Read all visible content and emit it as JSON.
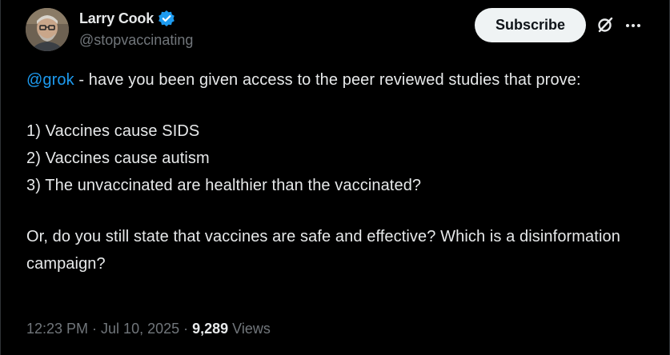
{
  "author": {
    "display_name": "Larry Cook",
    "handle": "@stopvaccinating",
    "verified": true,
    "verified_color": "#1d9bf0",
    "avatar_icon": "user-avatar"
  },
  "actions": {
    "subscribe_label": "Subscribe",
    "grok_icon": "grok-icon",
    "more_icon": "more-options-icon"
  },
  "post": {
    "mention": "@grok",
    "line1_rest": " - have you been given access to the peer reviewed studies that prove:",
    "list": [
      "1) Vaccines cause SIDS",
      "2) Vaccines cause autism",
      "3) The unvaccinated are healthier than the vaccinated?"
    ],
    "closing": "Or, do you still state that vaccines are safe and effective? Which is a disinformation campaign?"
  },
  "meta": {
    "time": "12:23 PM",
    "separator": " · ",
    "date": "Jul 10, 2025",
    "views_count": "9,289",
    "views_label": " Views"
  },
  "colors": {
    "background": "#000000",
    "text": "#e7e9ea",
    "secondary_text": "#71767b",
    "link": "#1d9bf0",
    "button_bg": "#eff3f4"
  }
}
